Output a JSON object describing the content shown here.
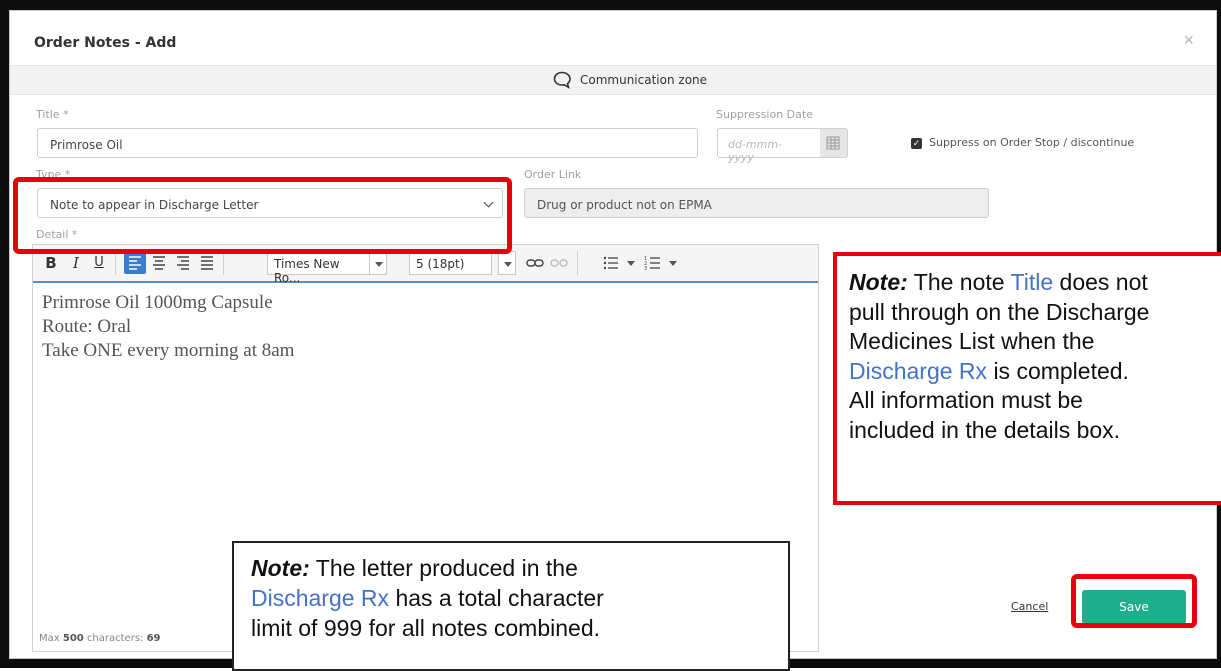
{
  "dialog": {
    "title": "Order Notes - Add",
    "close_glyph": "×",
    "communication_zone": "Communication zone"
  },
  "form": {
    "title_label": "Title *",
    "title_value": "Primrose Oil",
    "suppression_label": "Suppression Date",
    "suppression_placeholder": "dd-mmm-yyyy",
    "suppress_checkbox_label": "Suppress on Order Stop / discontinue",
    "suppress_checked": true,
    "type_label": "Type *",
    "type_value": "Note to appear in Discharge Letter",
    "order_link_label": "Order Link",
    "order_link_value": "Drug or product not on EPMA",
    "detail_label": "Detail *"
  },
  "toolbar": {
    "bold": "B",
    "italic": "I",
    "underline": "U",
    "font_family": "Times New Ro...",
    "font_size": "5 (18pt)"
  },
  "editor": {
    "lines": [
      "Primrose Oil 1000mg Capsule",
      "Route: Oral",
      "Take ONE every morning at 8am"
    ],
    "max_prefix": "Max",
    "max_value": "500",
    "chars_label": "characters:",
    "chars_value": "69"
  },
  "actions": {
    "cancel": "Cancel",
    "save": "Save"
  },
  "callouts": {
    "right": {
      "note": "Note:",
      "t1": "The note",
      "t2": "Title",
      "t3": "does not",
      "line2": "pull through on the Discharge",
      "line3": "Medicines List when the",
      "t4": "Discharge Rx",
      "t5": "is completed.",
      "line5": "All information must be",
      "line6": "included in the details box."
    },
    "bottom": {
      "note": "Note:",
      "t1": "The letter produced in the",
      "t2": "Discharge Rx",
      "t3": "has a total character",
      "line3": "limit of 999 for all notes combined."
    }
  },
  "colors": {
    "highlight_red": "#e8000d",
    "save_green": "#1fae8b",
    "link_blue": "#4472c4",
    "toolbar_active": "#3b7ccc"
  }
}
